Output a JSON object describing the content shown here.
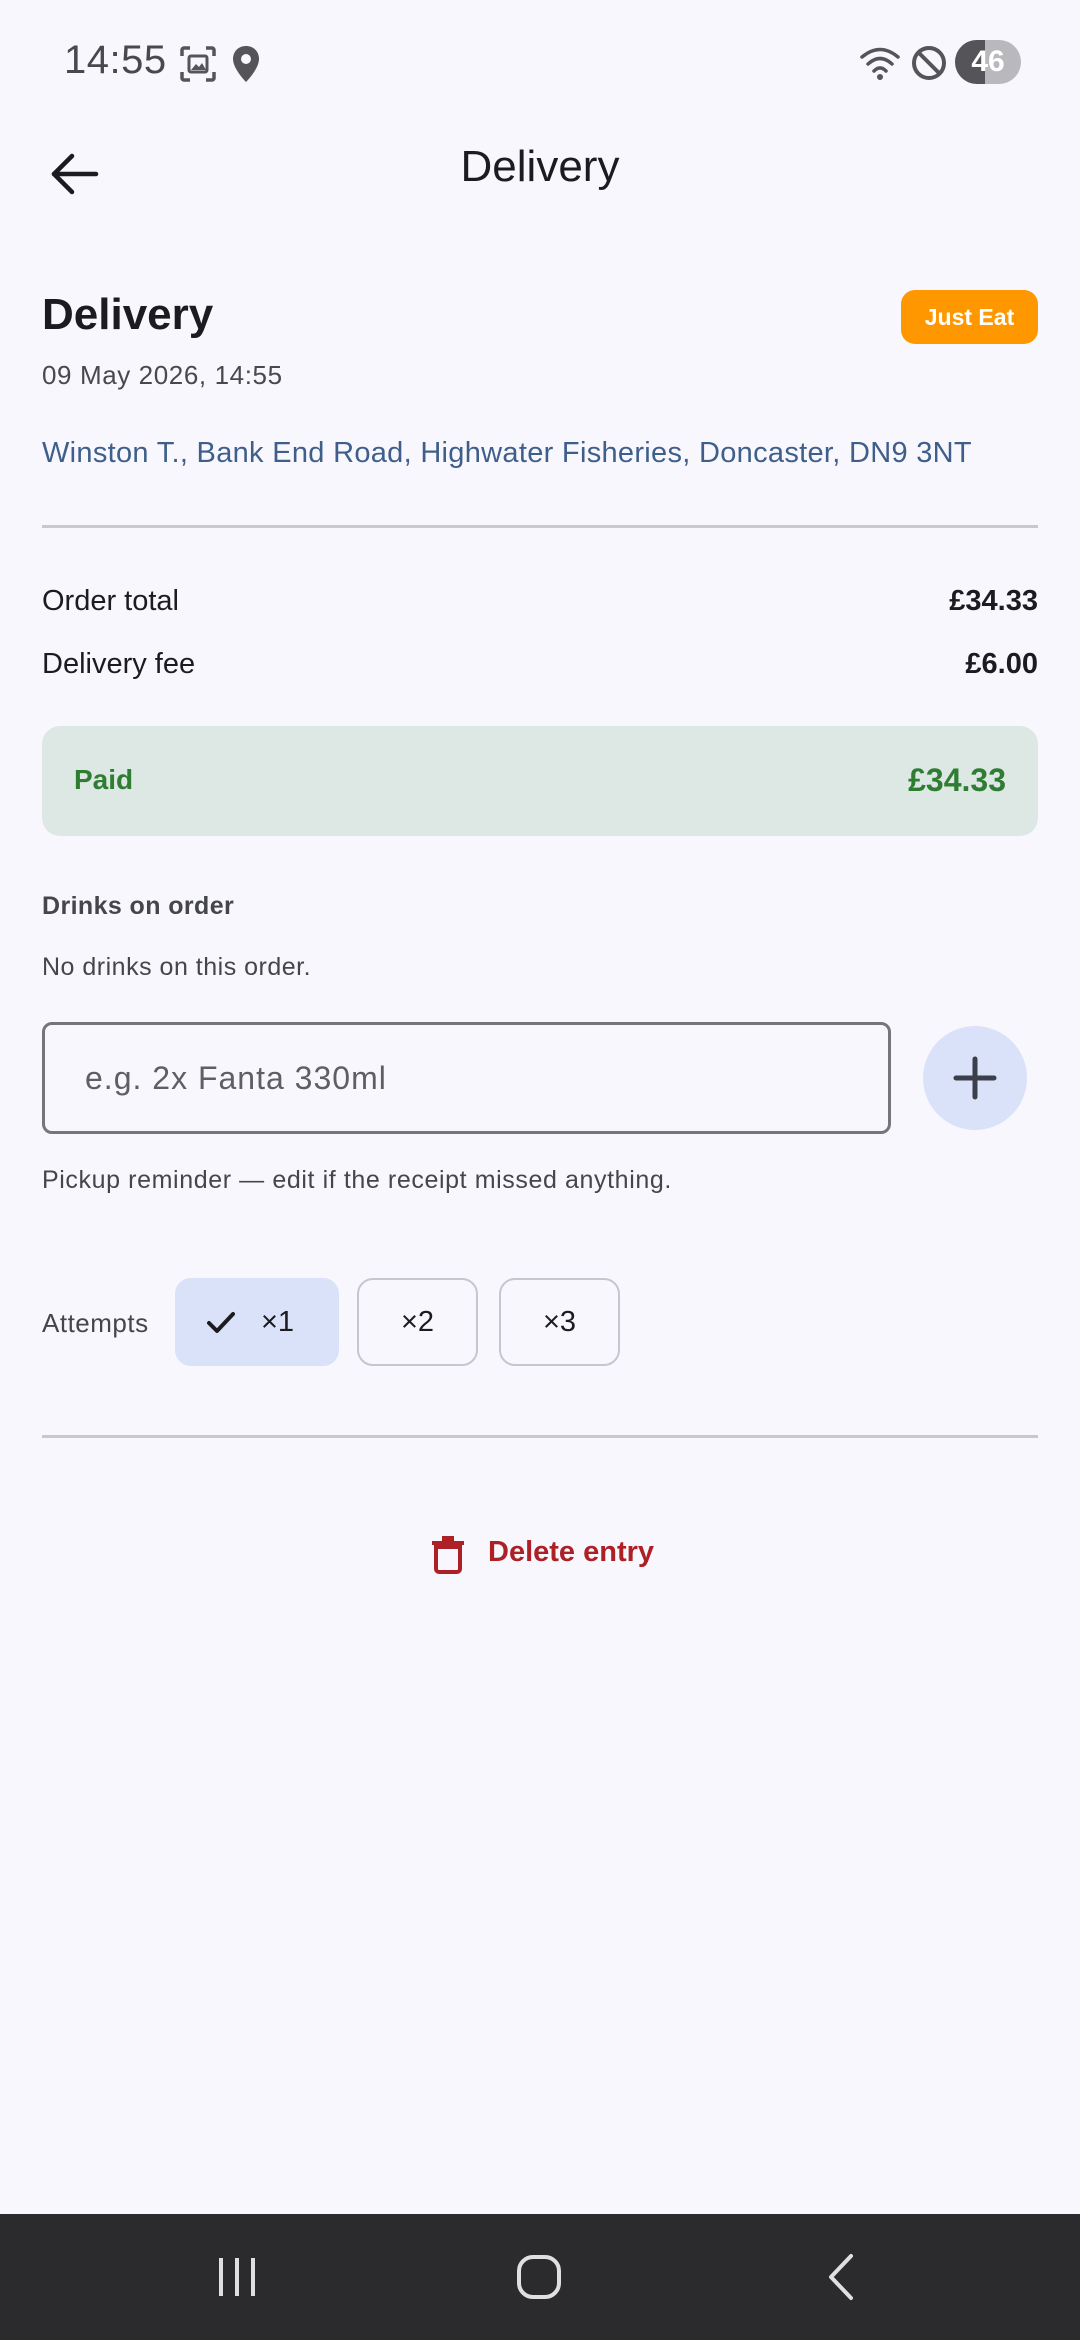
{
  "status_bar": {
    "time": "14:55",
    "battery": "46",
    "battery_level": 0.46,
    "icons": [
      "screenshot-icon",
      "location-icon",
      "wifi-icon",
      "do-not-disturb-icon",
      "battery-icon"
    ]
  },
  "app_bar": {
    "title": "Delivery",
    "back_icon": "arrow-left-icon"
  },
  "entry": {
    "heading": "Delivery",
    "platform_badge": "Just Eat",
    "date": "09 May 2026, 14:55",
    "address": "Winston T., Bank End Road, Highwater Fisheries, Doncaster, DN9 3NT"
  },
  "totals": {
    "order_total_label": "Order total",
    "order_total_value": "£34.33",
    "delivery_fee_label": "Delivery fee",
    "delivery_fee_value": "£6.00",
    "paid_label": "Paid",
    "paid_value": "£34.33"
  },
  "drinks": {
    "title": "Drinks on order",
    "empty_note": "No drinks on this order.",
    "input_value": "",
    "input_placeholder": "e.g. 2x Fanta 330ml",
    "hint": "Pickup reminder — edit if the receipt missed anything."
  },
  "attempts": {
    "label": "Attempts",
    "options": [
      {
        "label": "×1",
        "selected": true
      },
      {
        "label": "×2",
        "selected": false
      },
      {
        "label": "×3",
        "selected": false
      }
    ]
  },
  "actions": {
    "delete_label": "Delete entry"
  },
  "colors": {
    "background": "#f8f7fd",
    "badge": "#ff9800",
    "paid_text": "#2e7d32",
    "paid_bg": "#dde7e3",
    "address": "#3f5f8a",
    "chip_selected": "#dae2f9",
    "delete": "#ac2026",
    "nav_bar": "#2b2b2d"
  }
}
